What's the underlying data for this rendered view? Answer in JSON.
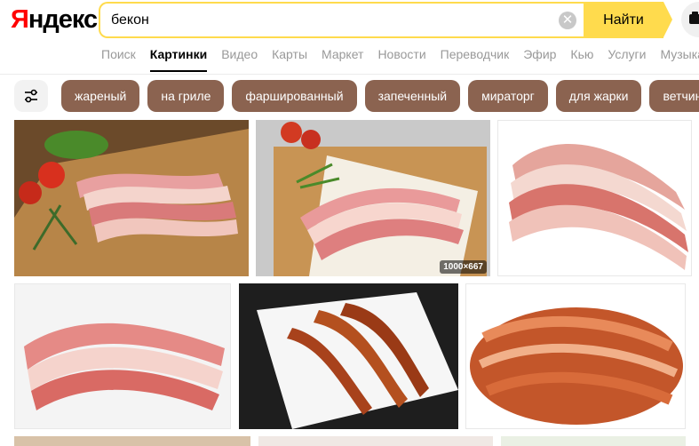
{
  "logo": {
    "first": "Я",
    "rest": "ндекс"
  },
  "search": {
    "query": "бекон",
    "button_label": "Найти",
    "clear_symbol": "✕"
  },
  "tabs": [
    {
      "label": "Поиск",
      "active": false
    },
    {
      "label": "Картинки",
      "active": true
    },
    {
      "label": "Видео",
      "active": false
    },
    {
      "label": "Карты",
      "active": false
    },
    {
      "label": "Маркет",
      "active": false
    },
    {
      "label": "Новости",
      "active": false
    },
    {
      "label": "Переводчик",
      "active": false
    },
    {
      "label": "Эфир",
      "active": false
    },
    {
      "label": "Кью",
      "active": false
    },
    {
      "label": "Услуги",
      "active": false
    },
    {
      "label": "Музыка",
      "active": false
    }
  ],
  "chips": [
    "жареный",
    "на гриле",
    "фаршированный",
    "запеченный",
    "мираторг",
    "для жарки",
    "ветчина"
  ],
  "results": [
    {
      "badge": ""
    },
    {
      "badge": "1000×667"
    },
    {
      "badge": ""
    },
    {
      "badge": ""
    },
    {
      "badge": ""
    },
    {
      "badge": ""
    }
  ],
  "colors": {
    "brand_red": "#ff0000",
    "search_yellow": "#ffdb4d",
    "chip_brown": "#8b6350"
  }
}
